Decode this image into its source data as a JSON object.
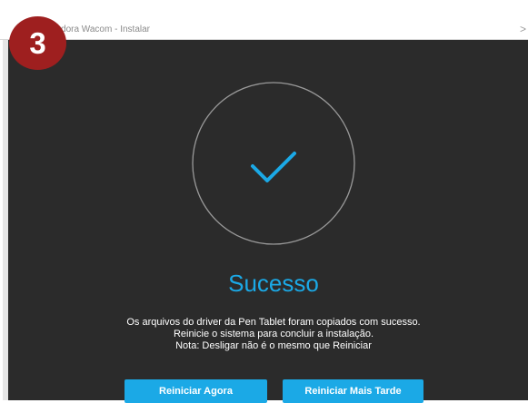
{
  "window": {
    "title": "lizadora Wacom - Instalar",
    "close_glyph": ">"
  },
  "badge": {
    "number": "3",
    "color": "#9e1f1f"
  },
  "success": {
    "icon": "checkmark-icon",
    "title": "Sucesso",
    "accent_color": "#1ba9e6"
  },
  "message": {
    "line1": "Os arquivos do driver da Pen Tablet foram copiados com sucesso.",
    "line2": "Reinicie o sistema para concluir a instalação.",
    "line3": "Nota: Desligar não é o mesmo que Reiniciar"
  },
  "buttons": {
    "restart_now": "Reiniciar Agora",
    "restart_later": "Reiniciar Mais Tarde"
  }
}
